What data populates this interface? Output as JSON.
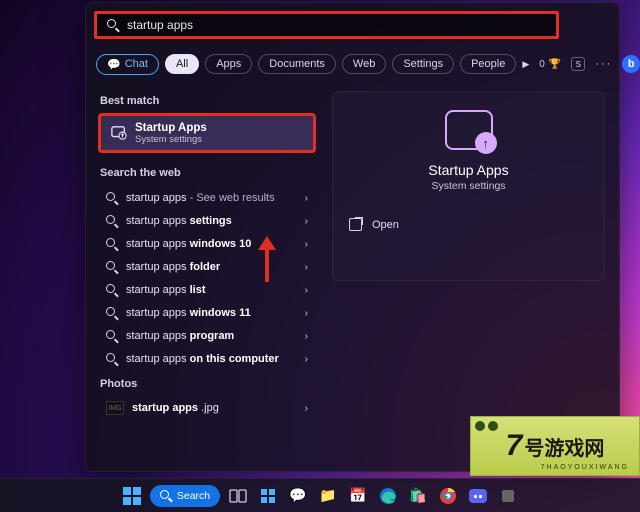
{
  "search": {
    "query": "startup apps"
  },
  "filters": {
    "chat": "Chat",
    "all": "All",
    "apps": "Apps",
    "documents": "Documents",
    "web": "Web",
    "settings": "Settings",
    "people": "People",
    "count_prefix": "0",
    "account_initial": "S"
  },
  "sections": {
    "best_match": "Best match",
    "search_web": "Search the web",
    "photos": "Photos"
  },
  "best_match": {
    "title": "Startup Apps",
    "subtitle": "System settings"
  },
  "web_results": [
    {
      "base": "startup apps",
      "suffix": " - See web results",
      "dim_suffix": true
    },
    {
      "base": "startup apps ",
      "bold": "settings"
    },
    {
      "base": "startup apps ",
      "bold": "windows 10"
    },
    {
      "base": "startup apps ",
      "bold": "folder"
    },
    {
      "base": "startup apps ",
      "bold": "list"
    },
    {
      "base": "startup apps ",
      "bold": "windows 11"
    },
    {
      "base": "startup apps ",
      "bold": "program"
    },
    {
      "base": "startup apps ",
      "bold": "on this computer"
    }
  ],
  "photos_result": {
    "base": "startup apps",
    "ext": " .jpg"
  },
  "detail": {
    "title": "Startup Apps",
    "subtitle": "System settings",
    "open": "Open"
  },
  "taskbar": {
    "search_label": "Search"
  },
  "watermark": {
    "text": "号游戏网",
    "num": "7",
    "url": "7HAOYOUXIWANG"
  }
}
